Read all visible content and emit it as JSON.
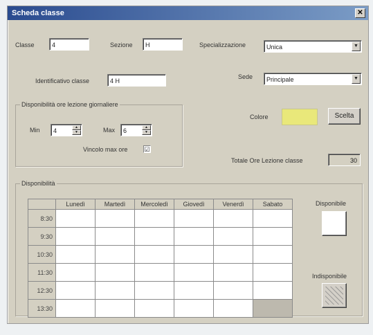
{
  "window": {
    "title": "Scheda classe",
    "close_glyph": "✕"
  },
  "classe": {
    "label": "Classe",
    "value": "4"
  },
  "sezione": {
    "label": "Sezione",
    "value": "H"
  },
  "specializzazione": {
    "label": "Specializzazione",
    "value": "Unica"
  },
  "identificativo": {
    "label": "Identificativo classe",
    "value": "4 H"
  },
  "sede": {
    "label": "Sede",
    "value": "Principale"
  },
  "disponibilita_ore": {
    "group_label": "Disponibilità ore lezione giornaliere",
    "min_label": "Min",
    "min_value": "4",
    "max_label": "Max",
    "max_value": "6",
    "vincolo_label": "Vincolo max ore",
    "vincolo_checked": "☑"
  },
  "colore": {
    "label": "Colore",
    "swatch": "#e9e87a",
    "button": "Scelta"
  },
  "totale": {
    "label": "Totale Ore Lezione classe",
    "value": "30"
  },
  "grid": {
    "group_label": "Disponibilità",
    "days": [
      "Lunedì",
      "Martedì",
      "Mercoledì",
      "Giovedì",
      "Venerdì",
      "Sabato"
    ],
    "times": [
      "8:30",
      "9:30",
      "10:30",
      "11:30",
      "12:30",
      "13:30"
    ]
  },
  "legend": {
    "available_label": "Disponibile",
    "unavailable_label": "Indisponibile"
  }
}
